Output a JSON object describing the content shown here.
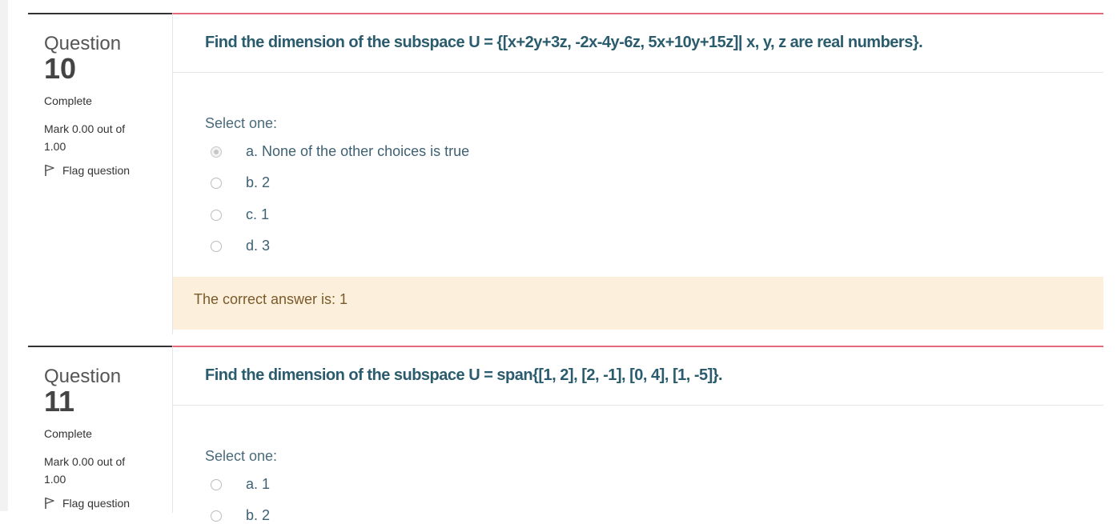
{
  "questions": [
    {
      "label": "Question",
      "number": "10",
      "state": "Complete",
      "grade": "Mark 0.00 out of 1.00",
      "flag": "Flag question",
      "text": "Find the dimension of the subspace U = {[x+2y+3z, -2x-4y-6z, 5x+10y+15z]| x, y, z are real numbers}.",
      "prompt": "Select one:",
      "options": [
        {
          "label": "a. None of the other choices is true",
          "checked": true
        },
        {
          "label": "b. 2",
          "checked": false
        },
        {
          "label": "c. 1",
          "checked": false
        },
        {
          "label": "d. 3",
          "checked": false
        }
      ],
      "feedback": "The correct answer is: 1"
    },
    {
      "label": "Question",
      "number": "11",
      "state": "Complete",
      "grade": "Mark 0.00 out of 1.00",
      "flag": "Flag question",
      "text": "Find the dimension of the subspace U = span{[1, 2], [2, -1], [0, 4], [1, -5]}.",
      "prompt": "Select one:",
      "options": [
        {
          "label": "a. 1",
          "checked": false
        },
        {
          "label": "b. 2",
          "checked": false
        }
      ]
    }
  ],
  "colors": {
    "accent": "#e36a7a",
    "question_text": "#2b5c6e",
    "feedback_bg": "#fcefdc"
  }
}
